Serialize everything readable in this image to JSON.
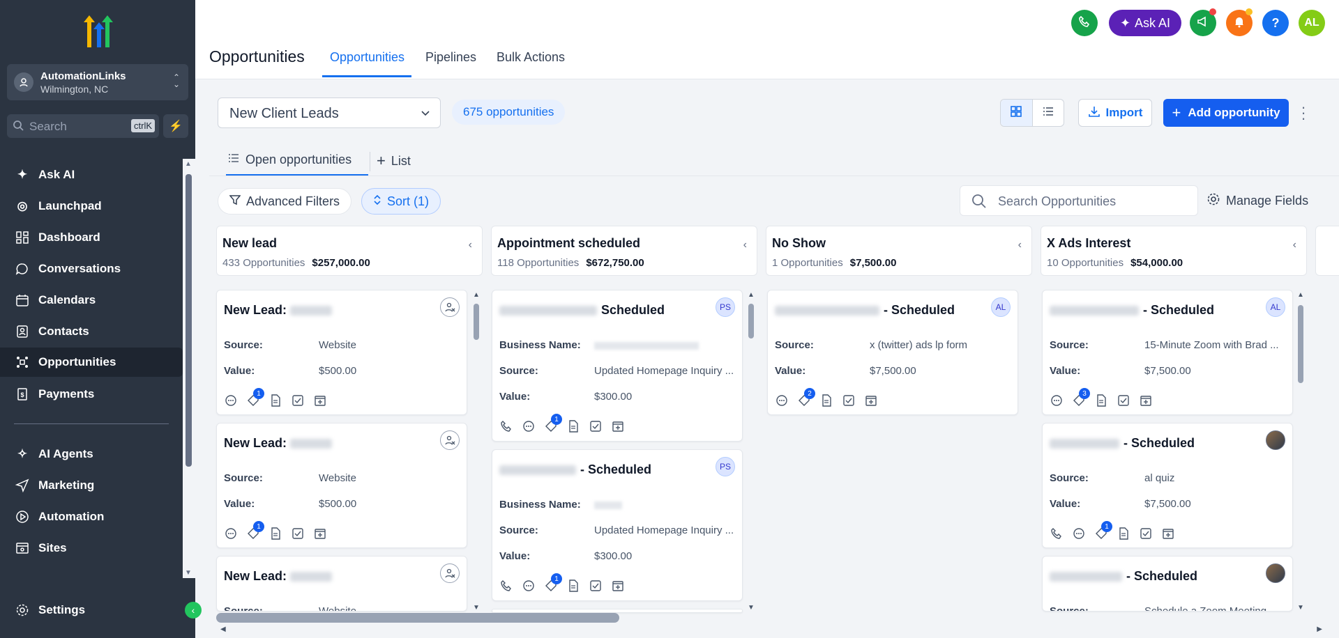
{
  "sidebar": {
    "account": {
      "name": "AutomationLinks",
      "location": "Wilmington, NC"
    },
    "search": {
      "placeholder": "Search",
      "shortcut": "ctrlK"
    },
    "items": [
      {
        "label": "Ask AI",
        "icon": "sparkle-icon"
      },
      {
        "label": "Launchpad",
        "icon": "rocket-icon"
      },
      {
        "label": "Dashboard",
        "icon": "dashboard-icon"
      },
      {
        "label": "Conversations",
        "icon": "chat-icon"
      },
      {
        "label": "Calendars",
        "icon": "calendar-icon"
      },
      {
        "label": "Contacts",
        "icon": "contacts-icon"
      },
      {
        "label": "Opportunities",
        "icon": "opportunities-icon",
        "active": true
      },
      {
        "label": "Payments",
        "icon": "payments-icon"
      },
      {
        "label": "AI Agents",
        "icon": "ai-agents-icon"
      },
      {
        "label": "Marketing",
        "icon": "send-icon"
      },
      {
        "label": "Automation",
        "icon": "automation-icon"
      },
      {
        "label": "Sites",
        "icon": "sites-icon"
      },
      {
        "label": "Settings",
        "icon": "gear-icon"
      }
    ]
  },
  "header": {
    "title": "Opportunities",
    "tabs": [
      {
        "label": "Opportunities",
        "active": true
      },
      {
        "label": "Pipelines"
      },
      {
        "label": "Bulk Actions"
      }
    ],
    "ask_ai": "Ask AI",
    "user_initials": "AL"
  },
  "toolbar": {
    "pipeline": "New Client Leads",
    "count": "675 opportunities",
    "import": "Import",
    "add": "Add opportunity"
  },
  "subtabs": {
    "open": "Open opportunities",
    "list": "List"
  },
  "filters": {
    "advanced": "Advanced Filters",
    "sort": "Sort (1)",
    "search_placeholder": "Search Opportunities",
    "manage": "Manage Fields"
  },
  "columns": [
    {
      "title": "New lead",
      "count": "433 Opportunities",
      "value": "$257,000.00"
    },
    {
      "title": "Appointment scheduled",
      "count": "118 Opportunities",
      "value": "$672,750.00"
    },
    {
      "title": "No Show",
      "count": "1 Opportunities",
      "value": "$7,500.00"
    },
    {
      "title": "X Ads Interest",
      "count": "10 Opportunities",
      "value": "$54,000.00"
    }
  ],
  "cards": {
    "c1": {
      "title": "New Lead:",
      "source_label": "Source:",
      "source": "Website",
      "value_label": "Value:",
      "value": "$500.00",
      "badge": "1"
    },
    "c2": {
      "title": "New Lead:",
      "source_label": "Source:",
      "source": "Website",
      "value_label": "Value:",
      "value": "$500.00",
      "badge": "1"
    },
    "c3": {
      "title": "New Lead:",
      "source_label": "Source:",
      "source": "Website"
    },
    "c4": {
      "title": "Scheduled",
      "avatar": "PS",
      "bn_label": "Business Name:",
      "source_label": "Source:",
      "source": "Updated Homepage Inquiry ...",
      "value_label": "Value:",
      "value": "$300.00",
      "badge": "1"
    },
    "c5": {
      "title": "- Scheduled",
      "avatar": "PS",
      "bn_label": "Business Name:",
      "source_label": "Source:",
      "source": "Updated Homepage Inquiry ...",
      "value_label": "Value:",
      "value": "$300.00",
      "badge": "1"
    },
    "c6": {
      "title": "- Scheduled",
      "avatar": "AL",
      "source_label": "Source:",
      "source": "x (twitter) ads lp form",
      "value_label": "Value:",
      "value": "$7,500.00",
      "badge": "2"
    },
    "c7": {
      "title": "- Scheduled",
      "avatar": "AL",
      "source_label": "Source:",
      "source": "15-Minute Zoom with Brad ...",
      "value_label": "Value:",
      "value": "$7,500.00",
      "badge": "3"
    },
    "c8": {
      "title": "- Scheduled",
      "source_label": "Source:",
      "source": "al quiz",
      "value_label": "Value:",
      "value": "$7,500.00",
      "badge": "1"
    },
    "c9": {
      "title": "- Scheduled",
      "source_label": "Source:",
      "source": "Schedule a Zoom Meeting ..."
    }
  },
  "colors": {
    "accent": "#155eef",
    "sidebar": "#2b3441",
    "active_tab": "#1570ef",
    "ask_ai": "#5b21b6"
  }
}
